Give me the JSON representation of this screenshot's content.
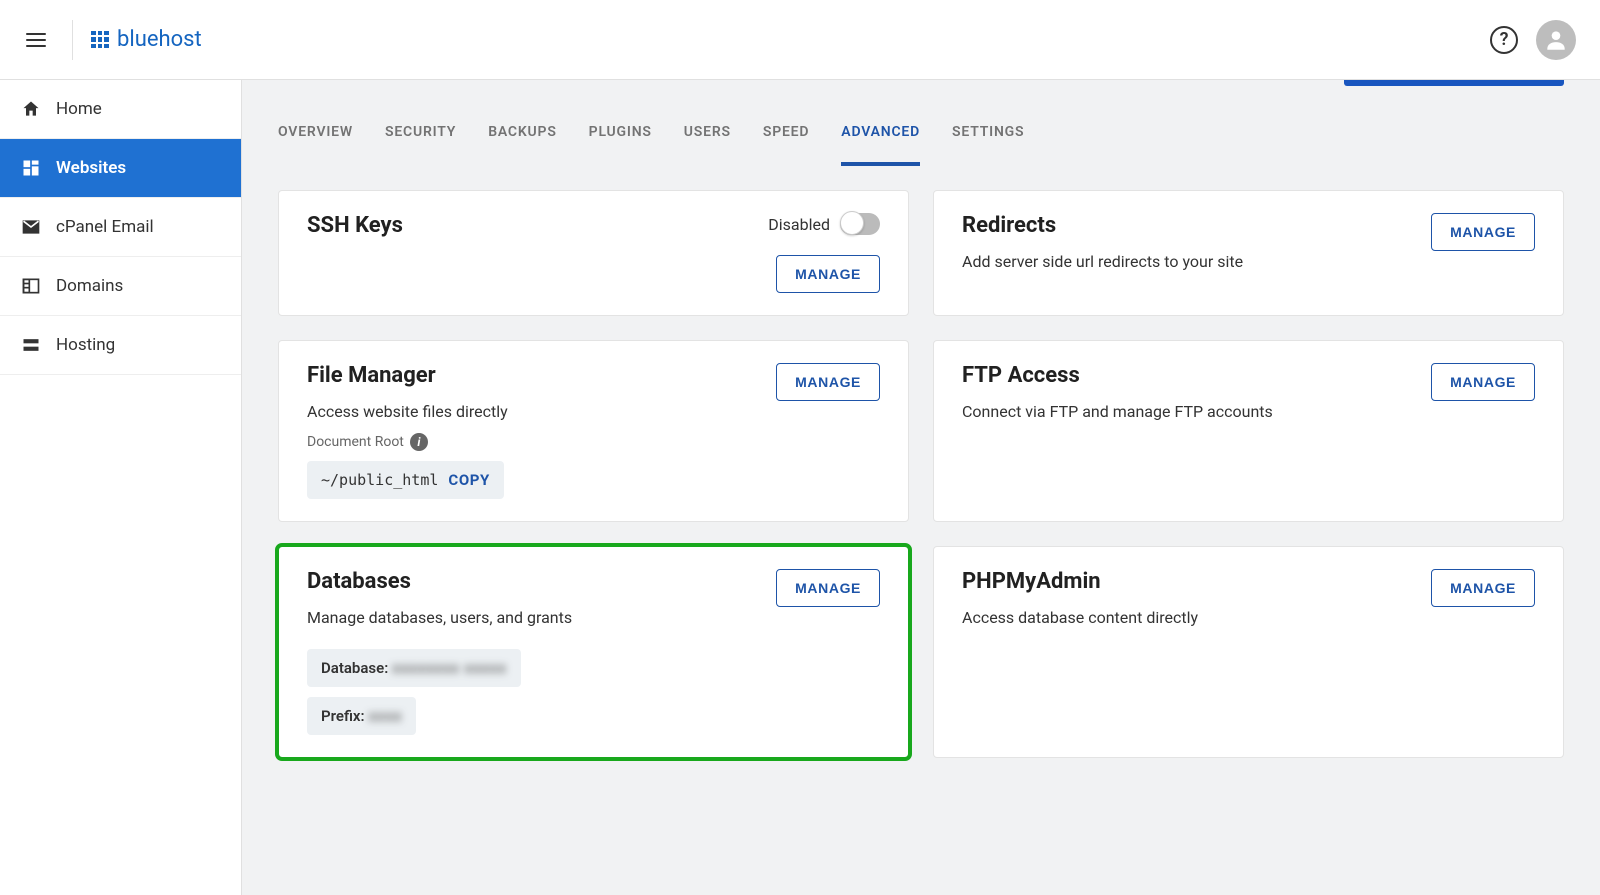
{
  "brand": {
    "name": "bluehost"
  },
  "sidebar": {
    "items": [
      {
        "label": "Home",
        "icon": "home-icon",
        "active": false
      },
      {
        "label": "Websites",
        "icon": "dashboard-icon",
        "active": true
      },
      {
        "label": "cPanel Email",
        "icon": "email-icon",
        "active": false
      },
      {
        "label": "Domains",
        "icon": "domain-icon",
        "active": false
      },
      {
        "label": "Hosting",
        "icon": "hosting-icon",
        "active": false
      }
    ]
  },
  "tabs": [
    {
      "label": "OVERVIEW",
      "active": false
    },
    {
      "label": "SECURITY",
      "active": false
    },
    {
      "label": "BACKUPS",
      "active": false
    },
    {
      "label": "PLUGINS",
      "active": false
    },
    {
      "label": "USERS",
      "active": false
    },
    {
      "label": "SPEED",
      "active": false
    },
    {
      "label": "ADVANCED",
      "active": true
    },
    {
      "label": "SETTINGS",
      "active": false
    }
  ],
  "cards": {
    "ssh": {
      "title": "SSH Keys",
      "toggle": {
        "label": "Disabled",
        "state": false
      },
      "manage": "MANAGE"
    },
    "redirects": {
      "title": "Redirects",
      "desc": "Add server side url redirects to your site",
      "manage": "MANAGE"
    },
    "file": {
      "title": "File Manager",
      "desc": "Access website files directly",
      "doc_root_label": "Document Root",
      "doc_root_path": "~/public_html",
      "copy": "COPY",
      "manage": "MANAGE"
    },
    "ftp": {
      "title": "FTP Access",
      "desc": "Connect via FTP and manage FTP accounts",
      "manage": "MANAGE"
    },
    "db": {
      "title": "Databases",
      "desc": "Manage databases, users, and grants",
      "database_label": "Database:",
      "database_value": "xxxxxxxx xxxxx",
      "prefix_label": "Prefix:",
      "prefix_value": "xxxx",
      "manage": "MANAGE"
    },
    "pma": {
      "title": "PHPMyAdmin",
      "desc": "Access database content directly",
      "manage": "MANAGE"
    }
  }
}
